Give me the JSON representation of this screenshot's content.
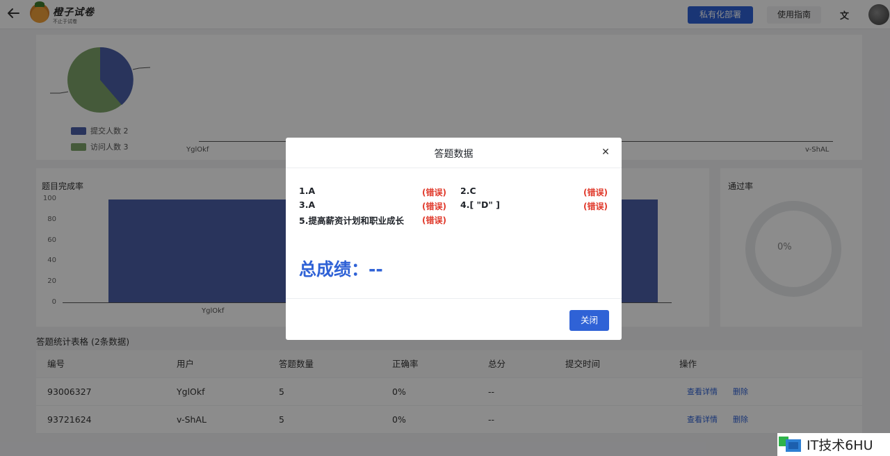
{
  "header": {
    "logo_title": "橙子试卷",
    "logo_subtitle": "不止于试卷",
    "deploy_label": "私有化部署",
    "guide_label": "使用指南"
  },
  "pie": {
    "legend": [
      {
        "label": "提交人数 2",
        "color": "#4c5fa8"
      },
      {
        "label": "访问人数 3",
        "color": "#7fa46a"
      }
    ]
  },
  "line_axis": {
    "left_label": "YglOkf",
    "right_label": "v-ShAL"
  },
  "completion_card": {
    "title": "题目完成率",
    "ticks": [
      "100",
      "80",
      "60",
      "40",
      "20",
      "0"
    ],
    "x_label": "YglOkf"
  },
  "pass_card": {
    "title": "通过率",
    "value": "0%"
  },
  "table": {
    "title": "答题统计表格 (2条数据)",
    "headers": [
      "编号",
      "用户",
      "答题数量",
      "正确率",
      "总分",
      "提交时间",
      "操作"
    ],
    "rows": [
      {
        "id": "93006327",
        "user": "YglOkf",
        "count": "5",
        "rate": "0%",
        "score": "--",
        "time": "",
        "view": "查看详情",
        "delete": "删除"
      },
      {
        "id": "93721624",
        "user": "v-ShAL",
        "count": "5",
        "rate": "0%",
        "score": "--",
        "time": "",
        "view": "查看详情",
        "delete": "删除"
      }
    ]
  },
  "modal": {
    "title": "答题数据",
    "answers": [
      {
        "text": "1.A",
        "status": "(错误)"
      },
      {
        "text": "2.C",
        "status": "(错误)"
      },
      {
        "text": "3.A",
        "status": "(错误)"
      },
      {
        "text": "4.[ \"D\" ]",
        "status": "(错误)"
      },
      {
        "text": "5.提高薪资计划和职业成长",
        "status": "(错误)"
      }
    ],
    "score_label": "总成绩：--",
    "close_label": "关闭"
  },
  "watermark": {
    "text": "IT技术6HU"
  },
  "colors": {
    "primary": "#2f62d6",
    "error": "#e0392b",
    "pie_submit": "#4c5fa8",
    "pie_visit": "#7fa46a"
  }
}
